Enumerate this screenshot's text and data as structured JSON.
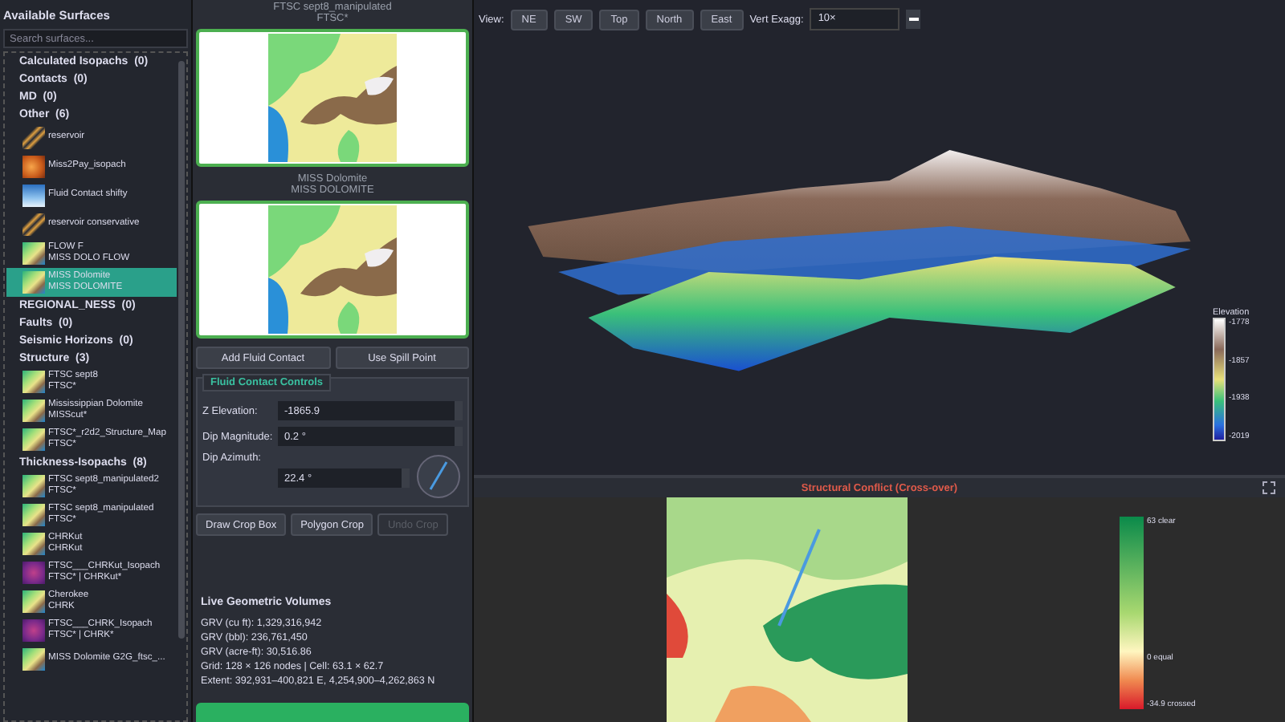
{
  "sidebar": {
    "title": "Available Surfaces",
    "search": {
      "placeholder": "Search surfaces..."
    },
    "groups": [
      {
        "label": "Calculated Isopachs",
        "count": "(0)"
      },
      {
        "label": "Contacts",
        "count": "(0)"
      },
      {
        "label": "MD",
        "count": "(0)"
      },
      {
        "label": "Other",
        "count": "(6)",
        "items": [
          {
            "name": "reservoir",
            "kind": "sparse",
            "selected": false
          },
          {
            "name": "Miss2Pay_isopach",
            "kind": "orange",
            "selected": false
          },
          {
            "name": "Fluid Contact shifty",
            "kind": "blue",
            "selected": false
          },
          {
            "name": "reservoir conservative",
            "kind": "sparse",
            "selected": false
          },
          {
            "name": "FLOW F",
            "sub": "MISS DOLO FLOW",
            "kind": "map",
            "selected": false
          },
          {
            "name": "MISS Dolomite",
            "sub": "MISS DOLOMITE",
            "kind": "map",
            "selected": true
          }
        ]
      },
      {
        "label": "REGIONAL_NESS",
        "count": "(0)"
      },
      {
        "label": "Faults",
        "count": "(0)"
      },
      {
        "label": "Seismic Horizons",
        "count": "(0)"
      },
      {
        "label": "Structure",
        "count": "(3)",
        "items": [
          {
            "name": "FTSC sept8",
            "sub": "FTSC*",
            "kind": "map",
            "selected": false
          },
          {
            "name": "Mississippian Dolomite",
            "sub": "MISScut*",
            "kind": "map",
            "selected": false
          },
          {
            "name": "FTSC*_r2d2_Structure_Map",
            "sub": "FTSC*",
            "kind": "map",
            "selected": false
          }
        ]
      },
      {
        "label": "Thickness-Isopachs",
        "count": "(8)",
        "items": [
          {
            "name": "FTSC sept8_manipulated2",
            "sub": "FTSC*",
            "kind": "map",
            "selected": false
          },
          {
            "name": "FTSC sept8_manipulated",
            "sub": "FTSC*",
            "kind": "map",
            "selected": false
          },
          {
            "name": "CHRKut",
            "sub": "CHRKut",
            "kind": "map",
            "selected": false
          },
          {
            "name": "FTSC___CHRKut_Isopach",
            "sub": "FTSC* | CHRKut*",
            "kind": "magenta",
            "selected": false
          },
          {
            "name": "Cherokee",
            "sub": "CHRK",
            "kind": "map",
            "selected": false
          },
          {
            "name": "FTSC___CHRK_Isopach",
            "sub": "FTSC* | CHRK*",
            "kind": "magenta",
            "selected": false
          },
          {
            "name": "MISS Dolomite G2G_ftsc_...",
            "kind": "map",
            "selected": false
          }
        ]
      }
    ]
  },
  "previews": [
    {
      "title": "FTSC sept8_manipulated",
      "sub": "FTSC*"
    },
    {
      "title": "MISS Dolomite",
      "sub": "MISS DOLOMITE"
    }
  ],
  "contact_buttons": [
    "Add Fluid Contact",
    "Use Spill Point"
  ],
  "controls": {
    "title": "Fluid Contact Controls",
    "fields": [
      {
        "label": "Z Elevation:",
        "value": "-1865.9"
      },
      {
        "label": "Dip Magnitude:",
        "value": "0.2 °"
      },
      {
        "label": "Dip Azimuth:",
        "value": "22.4 °"
      }
    ]
  },
  "crop_buttons": [
    {
      "label": "Draw Crop Box",
      "disabled": false
    },
    {
      "label": "Polygon Crop",
      "disabled": false
    },
    {
      "label": "Undo Crop",
      "disabled": true
    }
  ],
  "volumes": {
    "title": "Live Geometric Volumes",
    "lines": [
      "GRV (cu ft): 1,329,316,942",
      "GRV (bbl): 236,761,450",
      "GRV (acre-ft): 30,516.86",
      "Grid: 128 × 126 nodes  |  Cell: 63.1 × 62.7",
      "Extent: 392,931–400,821 E, 4,254,900–4,262,863 N"
    ]
  },
  "toolbar": {
    "view_label": "View:",
    "views": [
      "NE",
      "SW",
      "Top",
      "North",
      "East"
    ],
    "exag_label": "Vert Exagg:",
    "exag_value": "10×"
  },
  "elevation_legend": {
    "title": "Elevation",
    "ticks": [
      "-1778",
      "-1857",
      "-1938",
      "-2019"
    ]
  },
  "conflict": {
    "title": "Structural Conflict (Cross-over)",
    "ticks": [
      "63  clear",
      "0  equal",
      "-34.9  crossed"
    ]
  }
}
